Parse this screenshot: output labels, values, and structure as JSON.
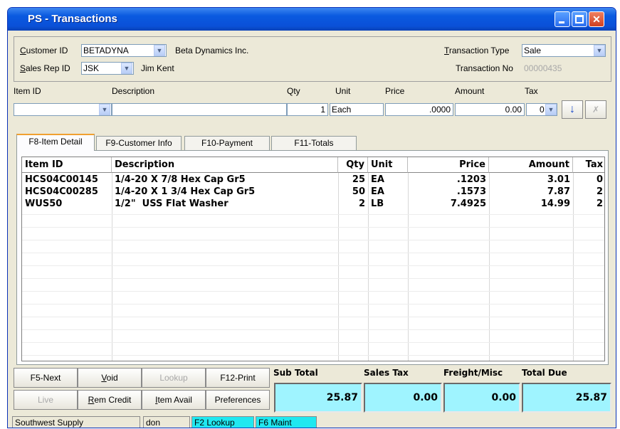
{
  "window": {
    "title": "PS - Transactions"
  },
  "customer": {
    "id_label": "Customer ID",
    "id_value": "BETADYNA",
    "name": "Beta Dynamics Inc.",
    "sales_rep_label": "Sales Rep ID",
    "sales_rep_value": "JSK",
    "sales_rep_name": "Jim Kent",
    "transaction_type_label": "Transaction Type",
    "transaction_type_value": "Sale",
    "transaction_no_label": "Transaction No",
    "transaction_no_value": "00000435"
  },
  "entry": {
    "headers": {
      "item_id": "Item ID",
      "description": "Description",
      "qty": "Qty",
      "unit": "Unit",
      "price": "Price",
      "amount": "Amount",
      "tax": "Tax"
    },
    "values": {
      "item_id": "",
      "description": "",
      "qty": "1",
      "unit": "Each",
      "price": ".0000",
      "amount": "0.00",
      "tax": "0"
    },
    "down_arrow_icon": "arrow-down-icon",
    "disabled_icon": "cancel-icon"
  },
  "tabs": [
    "F8-Item Detail",
    "F9-Customer Info",
    "F10-Payment",
    "F11-Totals"
  ],
  "grid": {
    "columns": [
      "Item ID",
      "Description",
      "Qty",
      "Unit",
      "Price",
      "Amount",
      "Tax"
    ],
    "rows": [
      {
        "item_id": "HCS04C00145",
        "description": "1/4-20 X 7/8 Hex Cap Gr5",
        "qty": "25",
        "unit": "EA",
        "price": ".1203",
        "amount": "3.01",
        "tax": "0"
      },
      {
        "item_id": "HCS04C00285",
        "description": "1/4-20 X 1 3/4 Hex Cap Gr5",
        "qty": "50",
        "unit": "EA",
        "price": ".1573",
        "amount": "7.87",
        "tax": "2"
      },
      {
        "item_id": "WUS50",
        "description": "1/2\"  USS Flat Washer",
        "qty": "2",
        "unit": "LB",
        "price": "7.4925",
        "amount": "14.99",
        "tax": "2"
      }
    ]
  },
  "buttons": {
    "next": "F5-Next",
    "void": "Void",
    "lookup": "Lookup",
    "print": "F12-Print",
    "live": "Live",
    "rem_credit": "Rem Credit",
    "item_avail": "Item Avail",
    "preferences": "Preferences"
  },
  "totals": {
    "sub_total_label": "Sub Total",
    "sub_total": "25.87",
    "sales_tax_label": "Sales Tax",
    "sales_tax": "0.00",
    "freight_label": "Freight/Misc",
    "freight": "0.00",
    "total_due_label": "Total Due",
    "total_due": "25.87"
  },
  "status": {
    "company": "Southwest Supply",
    "user": "don",
    "lookup_key": "F2 Lookup",
    "maint_key": "F6 Maint"
  },
  "colors": {
    "title_bar": "#0a5ae0",
    "totals_bg": "#9ff4ff",
    "status_key_bg": "#20e8f0",
    "tab_accent": "#f0a030"
  }
}
